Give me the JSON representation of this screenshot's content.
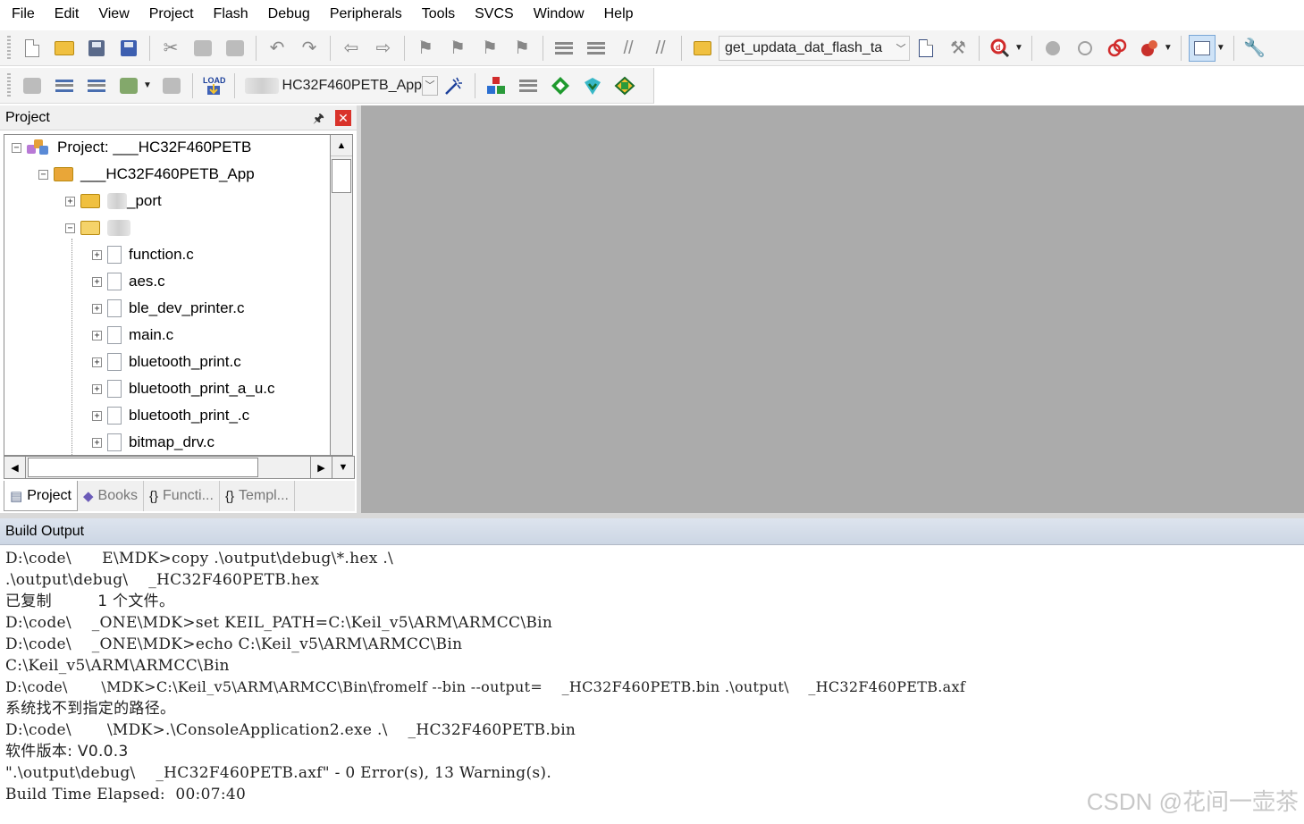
{
  "menu": [
    "File",
    "Edit",
    "View",
    "Project",
    "Flash",
    "Debug",
    "Peripherals",
    "Tools",
    "SVCS",
    "Window",
    "Help"
  ],
  "toolbar1": {
    "function_combo": "get_updata_dat_flash_ta"
  },
  "toolbar2": {
    "target_combo": "HC32F460PETB_App",
    "load_label": "LOAD"
  },
  "project_panel": {
    "title": "Project",
    "pin_glyph": "📌",
    "close_glyph": "✕",
    "tree": {
      "root": "Project: ___HC32F460PETB",
      "target": "___HC32F460PETB_App",
      "folder_port": "_port",
      "files": [
        "function.c",
        "aes.c",
        "ble_dev_printer.c",
        "main.c",
        "bluetooth_print.c",
        "bluetooth_print_a_u.c",
        "bluetooth_print_.c",
        "bitmap_drv.c"
      ]
    },
    "tabs": [
      "Project",
      "Books",
      "Functi...",
      "Templ..."
    ]
  },
  "build_output": {
    "title": "Build Output",
    "lines": [
      "D:\\code\\      E\\MDK>copy .\\output\\debug\\*.hex .\\",
      ".\\output\\debug\\    _HC32F460PETB.hex",
      "已复制         1 个文件。",
      "D:\\code\\    _ONE\\MDK>set KEIL_PATH=C:\\Keil_v5\\ARM\\ARMCC\\Bin",
      "D:\\code\\    _ONE\\MDK>echo C:\\Keil_v5\\ARM\\ARMCC\\Bin",
      "C:\\Keil_v5\\ARM\\ARMCC\\Bin",
      "D:\\code\\       \\MDK>C:\\Keil_v5\\ARM\\ARMCC\\Bin\\fromelf --bin --output=    _HC32F460PETB.bin .\\output\\    _HC32F460PETB.axf",
      "系统找不到指定的路径。",
      "D:\\code\\       \\MDK>.\\ConsoleApplication2.exe .\\    _HC32F460PETB.bin",
      "软件版本: V0.0.3",
      "\".\\output\\debug\\    _HC32F460PETB.axf\" - 0 Error(s), 13 Warning(s).",
      "Build Time Elapsed:  00:07:40"
    ]
  },
  "watermark": "CSDN @花间一壶茶",
  "colors": {
    "editor_bg": "#ababab",
    "close_red": "#d9332b",
    "folder_yellow": "#f0c040"
  }
}
